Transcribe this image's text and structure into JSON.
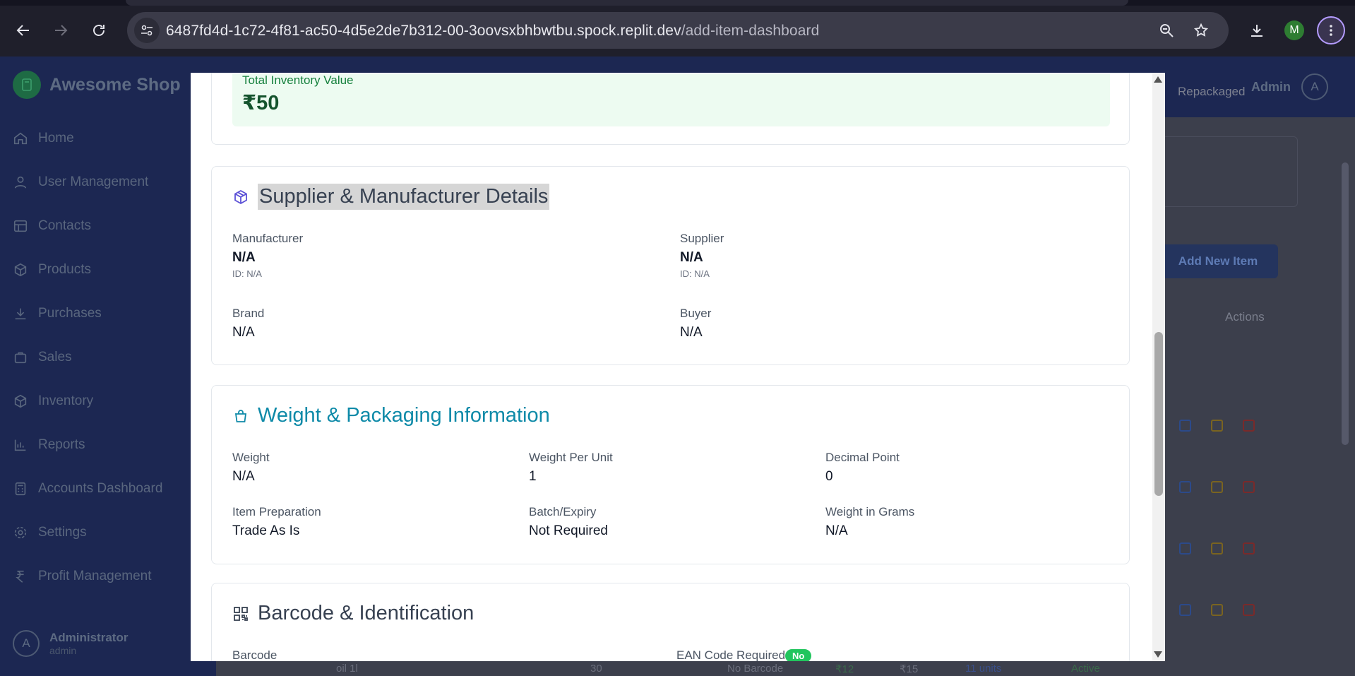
{
  "browser": {
    "url_host": "6487fd4d-1c72-4f81-ac50-4d5e2de7b312-00-3oovsxbhbwtbu.spock.replit.dev",
    "url_path": "/add-item-dashboard",
    "profile_initial": "M"
  },
  "app": {
    "brand": "Awesome Shop",
    "nav": [
      {
        "label": "Home",
        "icon": "home-icon"
      },
      {
        "label": "User Management",
        "icon": "user-icon"
      },
      {
        "label": "Contacts",
        "icon": "contacts-icon"
      },
      {
        "label": "Products",
        "icon": "box-icon"
      },
      {
        "label": "Purchases",
        "icon": "download-icon"
      },
      {
        "label": "Sales",
        "icon": "bag-icon"
      },
      {
        "label": "Inventory",
        "icon": "box-icon"
      },
      {
        "label": "Reports",
        "icon": "chart-icon"
      },
      {
        "label": "Accounts Dashboard",
        "icon": "calculator-icon"
      },
      {
        "label": "Settings",
        "icon": "gear-icon"
      },
      {
        "label": "Profit Management",
        "icon": "rupee-icon"
      }
    ],
    "user": {
      "name": "Administrator",
      "role": "admin",
      "initial": "A"
    },
    "topbar": {
      "admin_label": "Admin",
      "admin_initial": "A"
    },
    "background": {
      "tab_repackaged": "Repackaged",
      "add_new_item": "Add New Item",
      "actions_header": "Actions",
      "row_partial": {
        "name": "oil 1l",
        "qty": "30",
        "barcode": "No Barcode",
        "mrp": "₹12",
        "price": "₹15",
        "stock": "11 units",
        "status": "Active"
      }
    }
  },
  "modal": {
    "total_inventory": {
      "label": "Total Inventory Value",
      "value": "₹50"
    },
    "supplier_section": {
      "title": "Supplier & Manufacturer Details",
      "manufacturer": {
        "label": "Manufacturer",
        "value": "N/A",
        "id": "ID: N/A"
      },
      "supplier": {
        "label": "Supplier",
        "value": "N/A",
        "id": "ID: N/A"
      },
      "brand": {
        "label": "Brand",
        "value": "N/A"
      },
      "buyer": {
        "label": "Buyer",
        "value": "N/A"
      }
    },
    "weight_section": {
      "title": "Weight & Packaging Information",
      "weight": {
        "label": "Weight",
        "value": "N/A"
      },
      "weight_per_unit": {
        "label": "Weight Per Unit",
        "value": "1"
      },
      "decimal_point": {
        "label": "Decimal Point",
        "value": "0"
      },
      "item_preparation": {
        "label": "Item Preparation",
        "value": "Trade As Is"
      },
      "batch_expiry": {
        "label": "Batch/Expiry",
        "value": "Not Required"
      },
      "weight_in_grams": {
        "label": "Weight in Grams",
        "value": "N/A"
      }
    },
    "barcode_section": {
      "title": "Barcode & Identification",
      "barcode_label": "Barcode",
      "ean_label": "EAN Code Required",
      "ean_value": "No"
    }
  },
  "colors": {
    "teal_title": "#0e8aa8",
    "green_value": "#14532d",
    "sidebar_bg": "#1c2752"
  }
}
